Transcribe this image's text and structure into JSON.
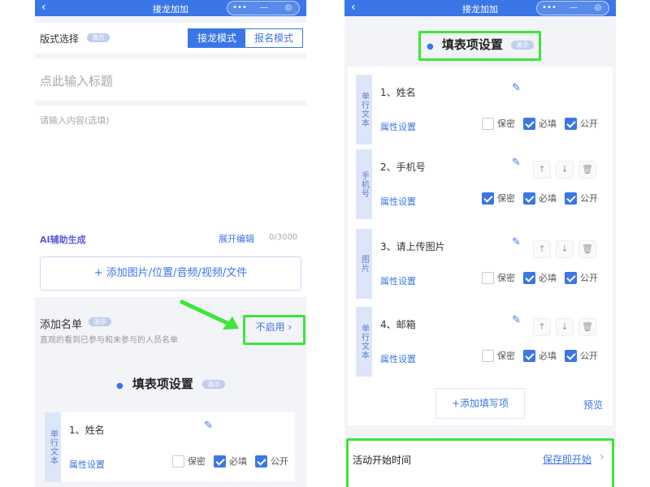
{
  "left": {
    "window_title": "接龙加加",
    "capsule": [
      "•••",
      "—",
      "◎"
    ],
    "format_label": "版式选择",
    "demo": "演示",
    "mode_jielong": "接龙模式",
    "mode_baoming": "报名模式",
    "title_placeholder": "点此输入标题",
    "content_placeholder": "请输入内容(选填)",
    "ai_label": "AI辅助生成",
    "expand_edit": "展开编辑",
    "counter": "0/3000",
    "add_media": "+ 添加图片/位置/音频/视频/文件",
    "name_list_title": "添加名单",
    "name_list_desc": "直观的看到已参与和未参与的人员名单",
    "disabled_label": "不启用",
    "form_title": "填表项设置",
    "field": {
      "type": "单行文本",
      "name": "1、姓名",
      "prop": "属性设置",
      "secret": "保密",
      "required": "必填",
      "public": "公开"
    }
  },
  "right": {
    "window_title": "接龙加加",
    "capsule": [
      "•••",
      "—",
      "◎"
    ],
    "form_title": "填表项设置",
    "demo": "演示",
    "fields": [
      {
        "type": "单行文本",
        "name": "1、姓名",
        "prop": "属性设置",
        "secret": "保密",
        "required": "必填",
        "public": "公开",
        "secret_on": false,
        "required_on": true,
        "public_on": true,
        "arrows": false
      },
      {
        "type": "手机号",
        "name": "2、手机号",
        "prop": "属性设置",
        "secret": "保密",
        "required": "必填",
        "public": "公开",
        "secret_on": true,
        "required_on": true,
        "public_on": true,
        "arrows": true
      },
      {
        "type": "图片",
        "name": "3、请上传图片",
        "prop": "属性设置",
        "secret": "保密",
        "required": "必填",
        "public": "公开",
        "secret_on": false,
        "required_on": true,
        "public_on": true,
        "arrows": true
      },
      {
        "type": "单行文本",
        "name": "4、邮箱",
        "prop": "属性设置",
        "secret": "保密",
        "required": "必填",
        "public": "公开",
        "secret_on": false,
        "required_on": true,
        "public_on": true,
        "arrows": true
      }
    ],
    "add_field": "+添加填写项",
    "preview": "预览",
    "start_time_label": "活动开始时间",
    "start_time_value": "保存即开始"
  },
  "colors": {
    "accent": "#3b76e8",
    "highlight": "#3ce63a",
    "titlebar": "#3a76e6"
  }
}
